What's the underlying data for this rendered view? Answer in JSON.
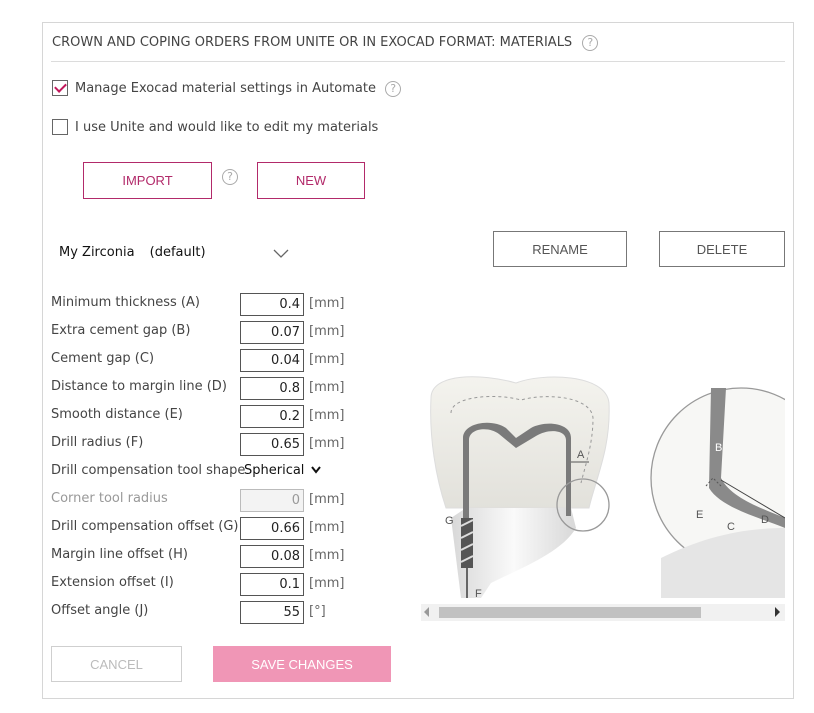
{
  "section_title": "CROWN AND COPING ORDERS FROM UNITE OR IN EXOCAD FORMAT: MATERIALS",
  "help_glyph": "?",
  "options": {
    "manage_exocad": {
      "label": "Manage Exocad material settings in Automate",
      "checked": true
    },
    "use_unite": {
      "label": "I use Unite and would like to edit my materials",
      "checked": false
    }
  },
  "buttons": {
    "import": "IMPORT",
    "new": "NEW",
    "rename": "RENAME",
    "delete": "DELETE",
    "cancel": "CANCEL",
    "save": "SAVE CHANGES"
  },
  "material": {
    "name": "My Zirconia",
    "tag": "(default)"
  },
  "parameters": [
    {
      "label": "Minimum thickness (A)",
      "value": "0.4",
      "unit": "[mm]"
    },
    {
      "label": "Extra cement gap (B)",
      "value": "0.07",
      "unit": "[mm]"
    },
    {
      "label": "Cement gap (C)",
      "value": "0.04",
      "unit": "[mm]"
    },
    {
      "label": "Distance to margin line (D)",
      "value": "0.8",
      "unit": "[mm]"
    },
    {
      "label": "Smooth distance (E)",
      "value": "0.2",
      "unit": "[mm]"
    },
    {
      "label": "Drill radius (F)",
      "value": "0.65",
      "unit": "[mm]"
    }
  ],
  "tool_shape": {
    "label": "Drill compensation tool shape",
    "value": "Spherical"
  },
  "parameters2": [
    {
      "label": "Corner tool radius",
      "value": "0",
      "unit": "[mm]",
      "disabled": true
    },
    {
      "label": "Drill compensation offset (G)",
      "value": "0.66",
      "unit": "[mm]"
    },
    {
      "label": "Margin line offset (H)",
      "value": "0.08",
      "unit": "[mm]"
    },
    {
      "label": "Extension offset (I)",
      "value": "0.1",
      "unit": "[mm]"
    },
    {
      "label": "Offset angle (J)",
      "value": "55",
      "unit": "[°]"
    }
  ],
  "diagram_labels": {
    "a": "A",
    "b": "B",
    "c": "C",
    "d": "D",
    "e": "E",
    "f": "F",
    "g": "G"
  },
  "colors": {
    "accent": "#b22a6a",
    "save_bg": "#f096b6"
  }
}
